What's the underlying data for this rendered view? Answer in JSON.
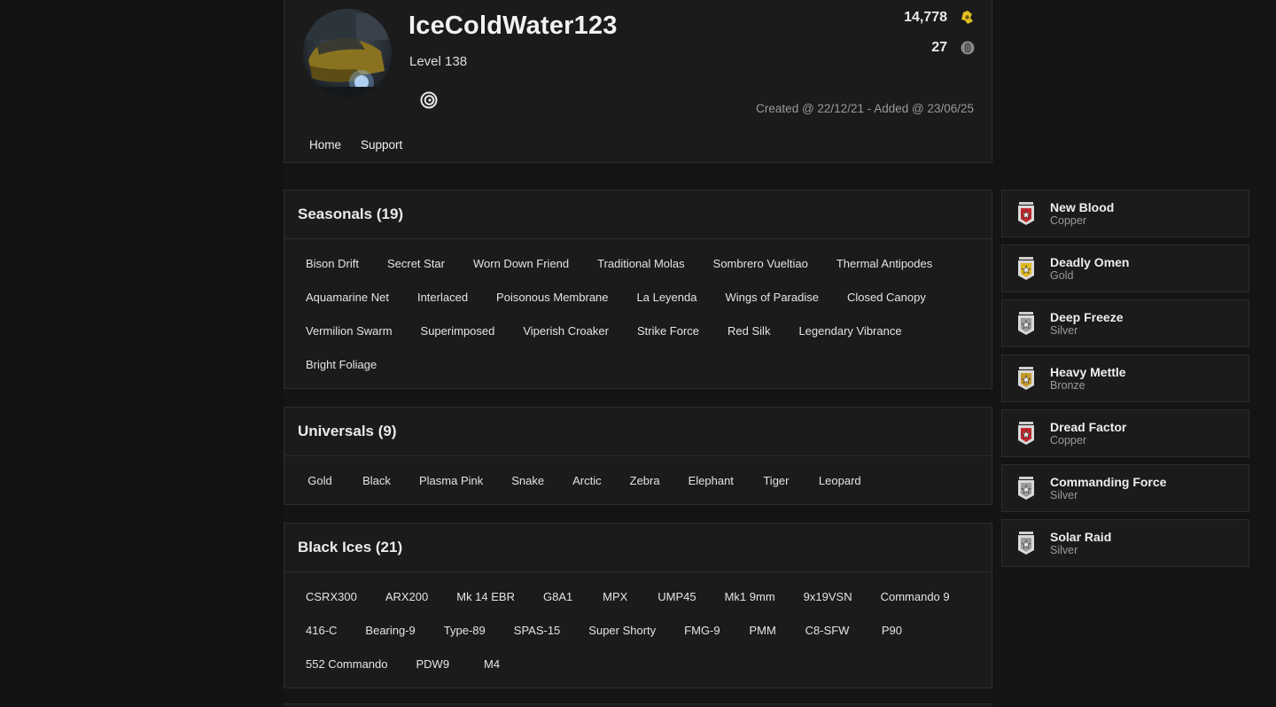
{
  "profile": {
    "username": "IceColdWater123",
    "level": "Level 138",
    "stat_primary": "14,778",
    "stat_secondary": "27",
    "created": "Created @ 22/12/21 - Added @ 23/06/25",
    "platform_icon": "ubisoft-icon",
    "stat_primary_icon": "renown-icon",
    "stat_secondary_icon": "credits-icon"
  },
  "nav": {
    "home": "Home",
    "support": "Support"
  },
  "seasonals": {
    "title": "Seasonals (19)",
    "items": [
      "Bison Drift",
      "Secret Star",
      "Worn Down Friend",
      "Traditional Molas",
      "Sombrero Vueltiao",
      "Thermal Antipodes",
      "Aquamarine Net",
      "Interlaced",
      "Poisonous Membrane",
      "La Leyenda",
      "Wings of Paradise",
      "Closed Canopy",
      "Vermilion Swarm",
      "Superimposed",
      "Viperish Croaker",
      "Strike Force",
      "Red Silk",
      "Legendary Vibrance",
      "Bright Foliage"
    ]
  },
  "universals": {
    "title": "Universals (9)",
    "items": [
      "Gold",
      "Black",
      "Plasma Pink",
      "Snake",
      "Arctic",
      "Zebra",
      "Elephant",
      "Tiger",
      "Leopard"
    ]
  },
  "black_ices": {
    "title": "Black Ices (21)",
    "items": [
      "CSRX300",
      "ARX200",
      "Mk 14 EBR",
      "G8A1",
      "MPX",
      "UMP45",
      "Mk1 9mm",
      "9x19VSN",
      "Commando 9",
      "416-C",
      "Bearing-9",
      "Type-89",
      "SPAS-15",
      "Super Shorty",
      "FMG-9",
      "PMM",
      "C8-SFW",
      "P90",
      "552 Commando",
      "PDW9",
      "M4"
    ]
  },
  "charms": [
    {
      "name": "New Blood",
      "tier": "Copper",
      "color": "#c0282d"
    },
    {
      "name": "Deadly Omen",
      "tier": "Gold",
      "color": "#e0b820"
    },
    {
      "name": "Deep Freeze",
      "tier": "Silver",
      "color": "#9a9a9a"
    },
    {
      "name": "Heavy Mettle",
      "tier": "Bronze",
      "color": "#c89a2a"
    },
    {
      "name": "Dread Factor",
      "tier": "Copper",
      "color": "#c0282d"
    },
    {
      "name": "Commanding Force",
      "tier": "Silver",
      "color": "#9a9a9a"
    },
    {
      "name": "Solar Raid",
      "tier": "Silver",
      "color": "#9a9a9a"
    }
  ],
  "colors": {
    "background": "#141414",
    "card": "#1b1b1b",
    "border": "#2c2c2c",
    "muted_text": "#9a9a9a"
  }
}
